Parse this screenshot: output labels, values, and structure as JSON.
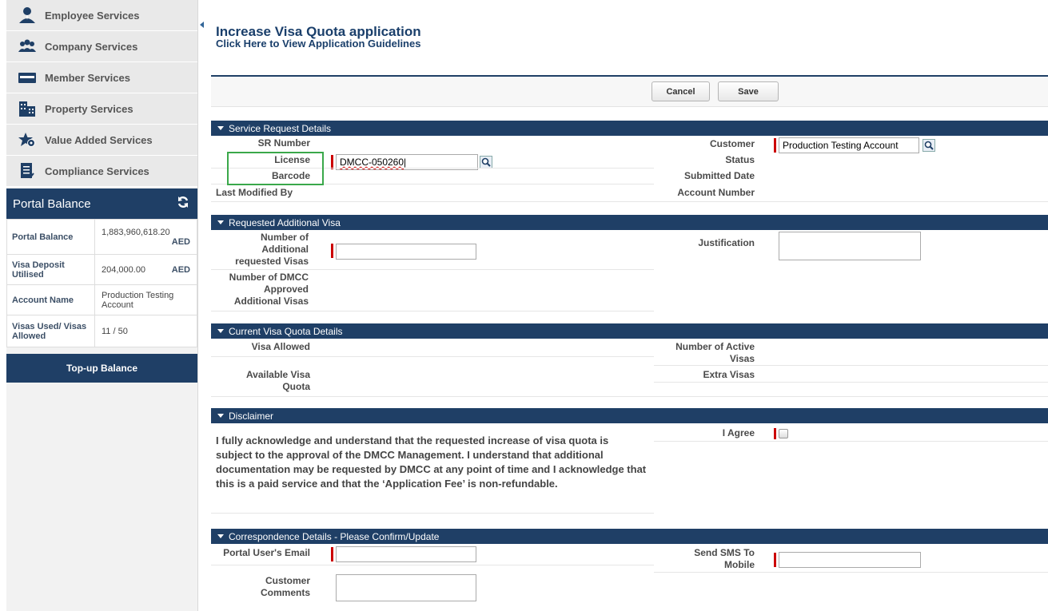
{
  "sidebar": {
    "items": [
      {
        "label": "Employee Services",
        "icon": "employee-icon"
      },
      {
        "label": "Company Services",
        "icon": "company-icon"
      },
      {
        "label": "Member Services",
        "icon": "member-card-icon"
      },
      {
        "label": "Property Services",
        "icon": "building-icon"
      },
      {
        "label": "Value Added Services",
        "icon": "star-gear-icon"
      },
      {
        "label": "Compliance Services",
        "icon": "document-check-icon"
      }
    ],
    "balance_title": "Portal Balance",
    "balance_rows": [
      {
        "label": "Portal Balance",
        "value": "1,883,960,618.20",
        "currency": "AED"
      },
      {
        "label": "Visa Deposit Utilised",
        "value": "204,000.00",
        "currency": "AED"
      },
      {
        "label": "Account Name",
        "value": "Production Testing Account",
        "currency": ""
      },
      {
        "label": "Visas Used/ Visas Allowed",
        "value": "11 / 50",
        "currency": ""
      }
    ],
    "topup_label": "Top-up Balance"
  },
  "main": {
    "title": "Increase Visa Quota application",
    "guide_link": "Click Here to View Application Guidelines",
    "cancel_label": "Cancel",
    "save_label": "Save"
  },
  "sections": {
    "service_request": {
      "title": "Service Request Details",
      "sr_number": "SR Number",
      "license": "License",
      "license_value": "DMCC-050260",
      "barcode": "Barcode",
      "last_modified": "Last Modified By",
      "customer": "Customer",
      "customer_value": "Production Testing Account",
      "status": "Status",
      "submitted_date": "Submitted Date",
      "account_number": "Account Number"
    },
    "requested_visa": {
      "title": "Requested Additional Visa",
      "num_requested": "Number of Additional requested Visas",
      "num_approved": "Number of DMCC Approved Additional Visas",
      "justification": "Justification"
    },
    "current_quota": {
      "title": "Current Visa Quota Details",
      "visa_allowed": "Visa Allowed",
      "available_quota": "Available Visa Quota",
      "active_visas": "Number of Active Visas",
      "extra_visas": "Extra Visas"
    },
    "disclaimer": {
      "title": "Disclaimer",
      "text": "I fully acknowledge and understand that the requested increase of visa quota is subject to the approval of the DMCC Management. I understand that additional documentation may be requested by DMCC at any point of time and I acknowledge that this is a paid service and that the ‘Application Fee’ is non-refundable.",
      "agree": "I Agree"
    },
    "correspondence": {
      "title": "Correspondence Details - Please Confirm/Update",
      "email": "Portal User's Email",
      "comments": "Customer Comments",
      "sms": "Send SMS To Mobile"
    }
  },
  "colors": {
    "navy": "#1f3f66",
    "required": "#cc0000",
    "highlight": "#3aa84a"
  }
}
